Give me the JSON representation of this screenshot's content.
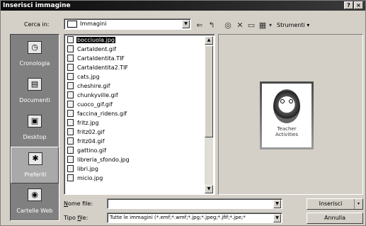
{
  "dialog": {
    "title": "Inserisci immagine",
    "help_glyph": "?",
    "close_glyph": "×"
  },
  "lookin": {
    "label": "Cerca in:",
    "value": "Immagini",
    "arrow": "▼"
  },
  "toolbar": {
    "back": "⇐",
    "up": "↰",
    "search": "◎",
    "delete": "✕",
    "new_folder": "▭",
    "views": "▦",
    "views_arrow": "▾",
    "tools_label": "Strumenti",
    "tools_arrow": "▾"
  },
  "places": [
    {
      "label": "Cronologia",
      "icon": "history-icon",
      "glyph": "◷",
      "active": false
    },
    {
      "label": "Documenti",
      "icon": "my-documents-icon",
      "glyph": "▤",
      "active": false
    },
    {
      "label": "Desktop",
      "icon": "desktop-icon",
      "glyph": "▣",
      "active": false
    },
    {
      "label": "Preferiti",
      "icon": "favorites-icon",
      "glyph": "✱",
      "active": true
    },
    {
      "label": "Cartelle Web",
      "icon": "web-folders-icon",
      "glyph": "◉",
      "active": false
    }
  ],
  "files": [
    {
      "name": "bocciuola.jpg",
      "type": "jpg",
      "selected": true
    },
    {
      "name": "CartaIdent.gif",
      "type": "gif",
      "selected": false
    },
    {
      "name": "CartaIdentita.TIF",
      "type": "tif",
      "selected": false
    },
    {
      "name": "CartaIdentita2.TIF",
      "type": "tif",
      "selected": false
    },
    {
      "name": "cats.jpg",
      "type": "jpg",
      "selected": false
    },
    {
      "name": "cheshire.gif",
      "type": "gif",
      "selected": false
    },
    {
      "name": "chunkyville.gif",
      "type": "gif",
      "selected": false
    },
    {
      "name": "cuoco_gif.gif",
      "type": "gif",
      "selected": false
    },
    {
      "name": "faccina_ridens.gif",
      "type": "gif",
      "selected": false
    },
    {
      "name": "fritz.jpg",
      "type": "jpg",
      "selected": false
    },
    {
      "name": "fritz02.gif",
      "type": "gif",
      "selected": false
    },
    {
      "name": "fritz04.gif",
      "type": "gif",
      "selected": false
    },
    {
      "name": "gattino.gif",
      "type": "gif",
      "selected": false
    },
    {
      "name": "libreria_sfondo.jpg",
      "type": "jpg",
      "selected": false
    },
    {
      "name": "libri.jpg",
      "type": "jpg",
      "selected": false
    },
    {
      "name": "micio.jpg",
      "type": "jpg",
      "selected": false
    }
  ],
  "scroll": {
    "up": "▲",
    "down": "▼"
  },
  "preview": {
    "caption_line1": "Teacher",
    "caption_line2": "Activities"
  },
  "filename": {
    "label_underlined": "N",
    "label_rest": "ome file:",
    "value": "",
    "arrow": "▼"
  },
  "filetype": {
    "label_prefix": "Tipo ",
    "label_underlined": "f",
    "label_rest": "ile:",
    "value": "Tutte le immagini (*.emf;*.wmf;*.jpg;*.jpeg;*.jfif;*.jpe;*",
    "arrow": "▼"
  },
  "buttons": {
    "insert": "Inserisci",
    "insert_arrow": "▾",
    "cancel": "Annulla"
  },
  "colors": {
    "selection": "#000000",
    "dialog_face": "#d4d0c8"
  }
}
